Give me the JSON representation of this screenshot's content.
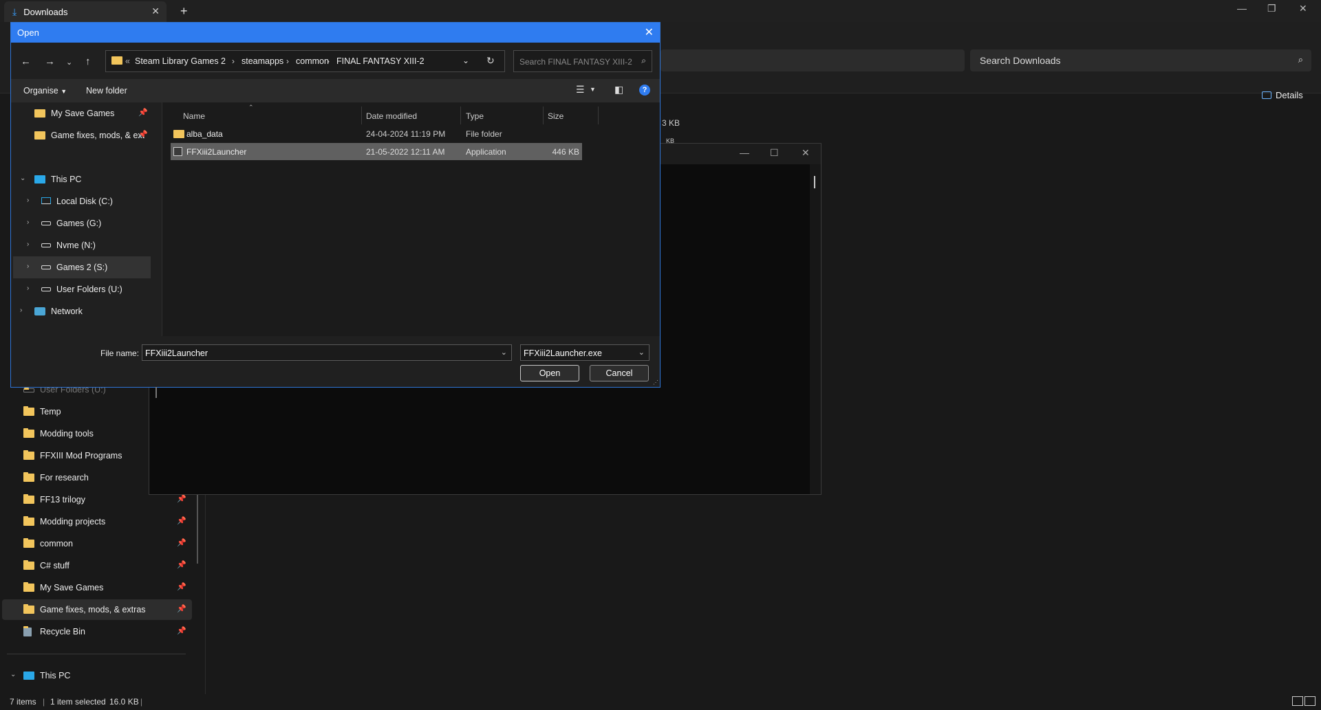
{
  "explorer": {
    "tab_title": "Downloads",
    "tab_close": "✕",
    "new_tab": "+",
    "search_placeholder": "Search Downloads",
    "details_label": "Details",
    "partial_size_1": "3 KB",
    "partial_size_2": "KB",
    "sidebar_items": [
      {
        "label": "User Folders (U:)",
        "pinned": false
      },
      {
        "label": "Temp",
        "pinned": false
      },
      {
        "label": "Modding tools",
        "pinned": false
      },
      {
        "label": "FFXIII Mod Programs",
        "pinned": false
      },
      {
        "label": "For research",
        "pinned": false
      },
      {
        "label": "FF13 trilogy",
        "pinned": true
      },
      {
        "label": "Modding projects",
        "pinned": true
      },
      {
        "label": "common",
        "pinned": true
      },
      {
        "label": "C# stuff",
        "pinned": true
      },
      {
        "label": "My Save Games",
        "pinned": true
      },
      {
        "label": "Game fixes, mods, & extras",
        "pinned": true
      },
      {
        "label": "Recycle Bin",
        "pinned": true
      }
    ],
    "this_pc_label": "This PC",
    "status": {
      "items": "7 items",
      "selected": "1 item selected",
      "size": "16.0 KB"
    }
  },
  "dialog": {
    "title": "Open",
    "breadcrumb": [
      "Steam Library Games 2",
      "steamapps",
      "common",
      "FINAL FANTASY XIII-2"
    ],
    "search_placeholder": "Search FINAL FANTASY XIII-2",
    "organise_label": "Organise",
    "new_folder_label": "New folder",
    "nav_items": [
      {
        "label": "My Save Games",
        "icon": "folder-icon",
        "pinned": true
      },
      {
        "label": "Game fixes, mods, & ext",
        "icon": "folder-icon",
        "pinned": true
      },
      {
        "label": "This PC",
        "icon": "pc-icon",
        "expanded": true
      },
      {
        "label": "Local Disk (C:)",
        "icon": "drive-icon"
      },
      {
        "label": "Games (G:)",
        "icon": "drive-icon"
      },
      {
        "label": "Nvme (N:)",
        "icon": "drive-icon"
      },
      {
        "label": "Games 2 (S:)",
        "icon": "drive-icon",
        "selected": true
      },
      {
        "label": "User Folders (U:)",
        "icon": "drive-icon"
      },
      {
        "label": "Network",
        "icon": "network-icon"
      }
    ],
    "columns": [
      "Name",
      "Date modified",
      "Type",
      "Size"
    ],
    "files": [
      {
        "name": "alba_data",
        "date": "24-04-2024 11:19 PM",
        "type": "File folder",
        "size": ""
      },
      {
        "name": "FFXiii2Launcher",
        "date": "21-05-2022 12:11 AM",
        "type": "Application",
        "size": "446 KB"
      }
    ],
    "file_name_label": "File name:",
    "file_name_value": "FFXiii2Launcher",
    "file_type_value": "FFXiii2Launcher.exe",
    "open_button": "Open",
    "cancel_button": "Cancel"
  },
  "colors": {
    "dialog_accent": "#2f7cf0",
    "folder": "#f2c55c",
    "selection": "#606060"
  }
}
